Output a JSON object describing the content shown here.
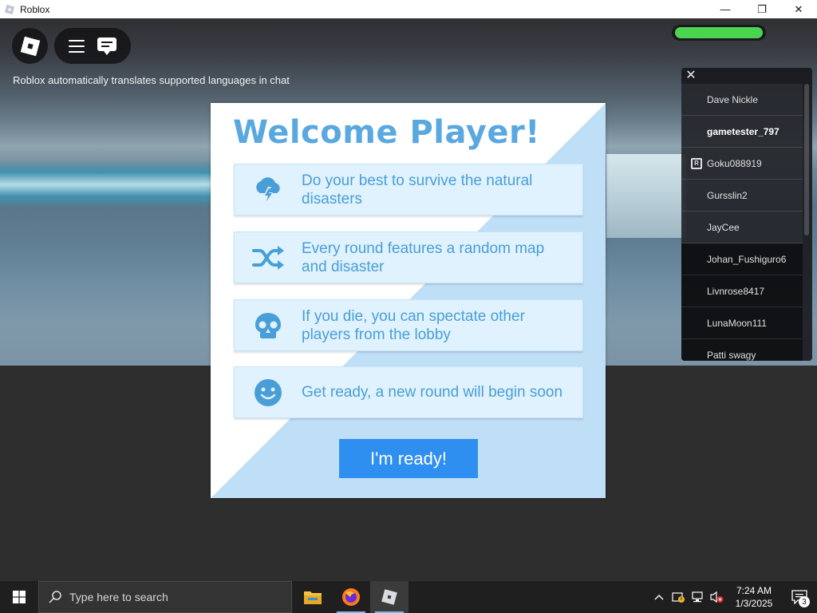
{
  "window": {
    "title": "Roblox",
    "icon": "roblox-icon"
  },
  "window_controls": {
    "minimize": "—",
    "restore": "❐",
    "close": "✕"
  },
  "hud": {
    "translate_note": "Roblox automatically translates supported languages in chat",
    "health_fraction": 1.0
  },
  "player_list": {
    "close_label": "✕",
    "players": [
      {
        "name": "Dave Nickle",
        "bold": false,
        "badge": ""
      },
      {
        "name": "gametester_797",
        "bold": true,
        "badge": ""
      },
      {
        "name": "Goku088919",
        "bold": false,
        "badge": "R"
      },
      {
        "name": "Gursslin2",
        "bold": false,
        "badge": ""
      },
      {
        "name": "JayCee",
        "bold": false,
        "badge": ""
      },
      {
        "name": "Johan_Fushiguro6",
        "bold": false,
        "badge": ""
      },
      {
        "name": "Livnrose8417",
        "bold": false,
        "badge": ""
      },
      {
        "name": "LunaMoon111",
        "bold": false,
        "badge": ""
      },
      {
        "name": "Patti swagy",
        "bold": false,
        "badge": ""
      }
    ]
  },
  "dialog": {
    "title": "Welcome Player!",
    "cards": [
      {
        "icon": "storm-cloud-icon",
        "text": "Do your best to survive the natural disasters"
      },
      {
        "icon": "shuffle-icon",
        "text": "Every round features a random map and disaster"
      },
      {
        "icon": "skull-icon",
        "text": "If you die, you can spectate other players from the lobby"
      },
      {
        "icon": "smiley-icon",
        "text": "Get ready, a new round will begin soon"
      }
    ],
    "button_label": "I'm ready!"
  },
  "taskbar": {
    "search_placeholder": "Type here to search",
    "apps": [
      "file-explorer-icon",
      "firefox-icon",
      "roblox-icon"
    ],
    "clock": {
      "time": "7:24 AM",
      "date": "1/3/2025"
    },
    "notification_count": "3"
  },
  "colors": {
    "accent": "#2f8ff0",
    "title_blue": "#5aa8e0",
    "card_bg": "#dff2fd",
    "health_green": "#4bd44f"
  }
}
